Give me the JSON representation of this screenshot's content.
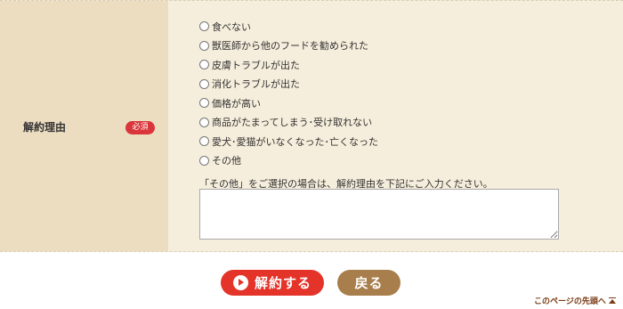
{
  "form": {
    "label": "解約理由",
    "required_badge": "必須",
    "options": [
      "食べない",
      "獣医師から他のフードを勧められた",
      "皮膚トラブルが出た",
      "消化トラブルが出た",
      "価格が高い",
      "商品がたまってしまう･受け取れない",
      "愛犬･愛猫がいなくなった･亡くなった",
      "その他"
    ],
    "note": "「その他」をご選択の場合は、解約理由を下記にご入力ください。",
    "textarea_value": ""
  },
  "buttons": {
    "submit_label": "解約する",
    "back_label": "戻る"
  },
  "footer": {
    "page_top_label": "このページの先頭へ"
  },
  "colors": {
    "form_background": "#f6eedc",
    "label_background": "#ecdcc0",
    "required_badge": "#d9353a",
    "submit_button": "#e4342a",
    "back_button": "#a87e4c",
    "page_top_link": "#7a3a14"
  }
}
